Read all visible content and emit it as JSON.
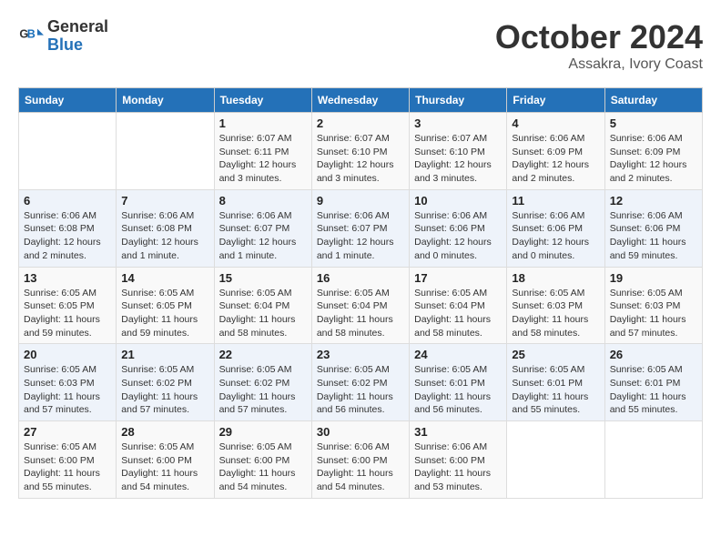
{
  "logo": {
    "line1": "General",
    "line2": "Blue"
  },
  "title": "October 2024",
  "subtitle": "Assakra, Ivory Coast",
  "days_of_week": [
    "Sunday",
    "Monday",
    "Tuesday",
    "Wednesday",
    "Thursday",
    "Friday",
    "Saturday"
  ],
  "weeks": [
    [
      {
        "day": "",
        "info": ""
      },
      {
        "day": "",
        "info": ""
      },
      {
        "day": "1",
        "info": "Sunrise: 6:07 AM\nSunset: 6:11 PM\nDaylight: 12 hours and 3 minutes."
      },
      {
        "day": "2",
        "info": "Sunrise: 6:07 AM\nSunset: 6:10 PM\nDaylight: 12 hours and 3 minutes."
      },
      {
        "day": "3",
        "info": "Sunrise: 6:07 AM\nSunset: 6:10 PM\nDaylight: 12 hours and 3 minutes."
      },
      {
        "day": "4",
        "info": "Sunrise: 6:06 AM\nSunset: 6:09 PM\nDaylight: 12 hours and 2 minutes."
      },
      {
        "day": "5",
        "info": "Sunrise: 6:06 AM\nSunset: 6:09 PM\nDaylight: 12 hours and 2 minutes."
      }
    ],
    [
      {
        "day": "6",
        "info": "Sunrise: 6:06 AM\nSunset: 6:08 PM\nDaylight: 12 hours and 2 minutes."
      },
      {
        "day": "7",
        "info": "Sunrise: 6:06 AM\nSunset: 6:08 PM\nDaylight: 12 hours and 1 minute."
      },
      {
        "day": "8",
        "info": "Sunrise: 6:06 AM\nSunset: 6:07 PM\nDaylight: 12 hours and 1 minute."
      },
      {
        "day": "9",
        "info": "Sunrise: 6:06 AM\nSunset: 6:07 PM\nDaylight: 12 hours and 1 minute."
      },
      {
        "day": "10",
        "info": "Sunrise: 6:06 AM\nSunset: 6:06 PM\nDaylight: 12 hours and 0 minutes."
      },
      {
        "day": "11",
        "info": "Sunrise: 6:06 AM\nSunset: 6:06 PM\nDaylight: 12 hours and 0 minutes."
      },
      {
        "day": "12",
        "info": "Sunrise: 6:06 AM\nSunset: 6:06 PM\nDaylight: 11 hours and 59 minutes."
      }
    ],
    [
      {
        "day": "13",
        "info": "Sunrise: 6:05 AM\nSunset: 6:05 PM\nDaylight: 11 hours and 59 minutes."
      },
      {
        "day": "14",
        "info": "Sunrise: 6:05 AM\nSunset: 6:05 PM\nDaylight: 11 hours and 59 minutes."
      },
      {
        "day": "15",
        "info": "Sunrise: 6:05 AM\nSunset: 6:04 PM\nDaylight: 11 hours and 58 minutes."
      },
      {
        "day": "16",
        "info": "Sunrise: 6:05 AM\nSunset: 6:04 PM\nDaylight: 11 hours and 58 minutes."
      },
      {
        "day": "17",
        "info": "Sunrise: 6:05 AM\nSunset: 6:04 PM\nDaylight: 11 hours and 58 minutes."
      },
      {
        "day": "18",
        "info": "Sunrise: 6:05 AM\nSunset: 6:03 PM\nDaylight: 11 hours and 58 minutes."
      },
      {
        "day": "19",
        "info": "Sunrise: 6:05 AM\nSunset: 6:03 PM\nDaylight: 11 hours and 57 minutes."
      }
    ],
    [
      {
        "day": "20",
        "info": "Sunrise: 6:05 AM\nSunset: 6:03 PM\nDaylight: 11 hours and 57 minutes."
      },
      {
        "day": "21",
        "info": "Sunrise: 6:05 AM\nSunset: 6:02 PM\nDaylight: 11 hours and 57 minutes."
      },
      {
        "day": "22",
        "info": "Sunrise: 6:05 AM\nSunset: 6:02 PM\nDaylight: 11 hours and 57 minutes."
      },
      {
        "day": "23",
        "info": "Sunrise: 6:05 AM\nSunset: 6:02 PM\nDaylight: 11 hours and 56 minutes."
      },
      {
        "day": "24",
        "info": "Sunrise: 6:05 AM\nSunset: 6:01 PM\nDaylight: 11 hours and 56 minutes."
      },
      {
        "day": "25",
        "info": "Sunrise: 6:05 AM\nSunset: 6:01 PM\nDaylight: 11 hours and 55 minutes."
      },
      {
        "day": "26",
        "info": "Sunrise: 6:05 AM\nSunset: 6:01 PM\nDaylight: 11 hours and 55 minutes."
      }
    ],
    [
      {
        "day": "27",
        "info": "Sunrise: 6:05 AM\nSunset: 6:00 PM\nDaylight: 11 hours and 55 minutes."
      },
      {
        "day": "28",
        "info": "Sunrise: 6:05 AM\nSunset: 6:00 PM\nDaylight: 11 hours and 54 minutes."
      },
      {
        "day": "29",
        "info": "Sunrise: 6:05 AM\nSunset: 6:00 PM\nDaylight: 11 hours and 54 minutes."
      },
      {
        "day": "30",
        "info": "Sunrise: 6:06 AM\nSunset: 6:00 PM\nDaylight: 11 hours and 54 minutes."
      },
      {
        "day": "31",
        "info": "Sunrise: 6:06 AM\nSunset: 6:00 PM\nDaylight: 11 hours and 53 minutes."
      },
      {
        "day": "",
        "info": ""
      },
      {
        "day": "",
        "info": ""
      }
    ]
  ]
}
